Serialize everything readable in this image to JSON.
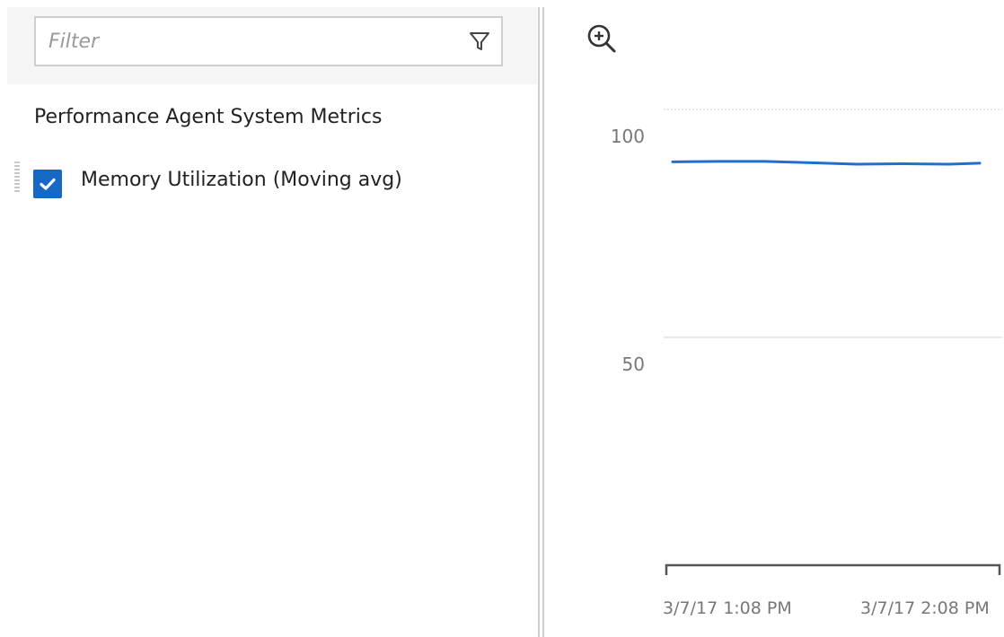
{
  "filter": {
    "placeholder": "Filter",
    "value": ""
  },
  "metrics_panel": {
    "group_title": "Performance Agent System Metrics",
    "items": [
      {
        "label": "Memory Utilization (Moving avg)",
        "checked": true
      }
    ]
  },
  "chart_data": {
    "type": "line",
    "y_ticks": [
      "100",
      "50"
    ],
    "x_ticks": [
      "3/7/17 1:08 PM",
      "3/7/17 2:08 PM"
    ],
    "ylim": [
      0,
      100
    ],
    "grid": true,
    "series": [
      {
        "color": "#1f6fd1",
        "points": [
          {
            "x": 0.0,
            "y": 88.5
          },
          {
            "x": 0.15,
            "y": 88.6
          },
          {
            "x": 0.3,
            "y": 88.6
          },
          {
            "x": 0.45,
            "y": 88.3
          },
          {
            "x": 0.6,
            "y": 88.0
          },
          {
            "x": 0.75,
            "y": 88.1
          },
          {
            "x": 0.9,
            "y": 88.0
          },
          {
            "x": 1.0,
            "y": 88.2
          }
        ]
      }
    ]
  },
  "colors": {
    "accent": "#1668c7",
    "series_line": "#1f6fd1",
    "gridline": "#e2e2e2",
    "axis": "#555555",
    "tick_text": "#777777"
  },
  "icons": {
    "filter": "filter-icon",
    "zoom": "zoom-in-icon",
    "check": "checkmark-icon",
    "drag": "drag-handle-icon"
  }
}
